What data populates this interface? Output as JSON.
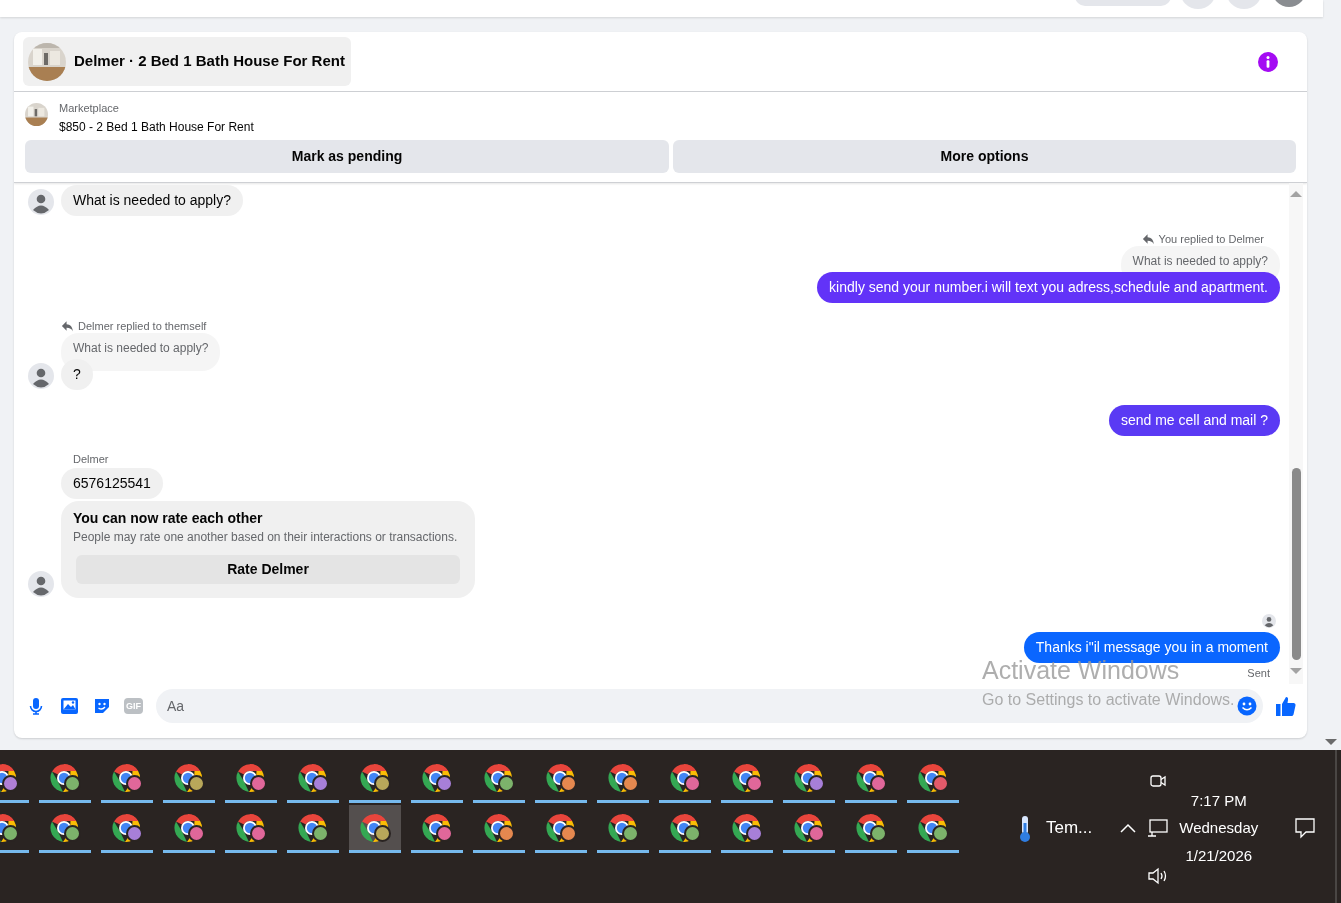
{
  "chat_header": {
    "title": "Delmer · 2 Bed 1 Bath House For Rent"
  },
  "listing": {
    "source": "Marketplace",
    "title": "$850 - 2 Bed 1 Bath House For Rent",
    "actions": [
      "Mark as pending",
      "More options"
    ]
  },
  "messages": [
    {
      "kind": "incoming",
      "avatar": true,
      "bubbles": [
        {
          "text": "What is needed to apply?"
        }
      ]
    },
    {
      "kind": "outgoing",
      "reply_note": "You replied to Delmer",
      "quoted": "What is needed to apply?",
      "bubbles": [
        {
          "text": "kindly send your number.i will text you adress,schedule and apartment.",
          "color": "#6233f8"
        }
      ]
    },
    {
      "kind": "incoming",
      "avatar": true,
      "reply_note": "Delmer replied to themself",
      "quoted": "What is needed to apply?",
      "bubbles": [
        {
          "text": "?"
        }
      ]
    },
    {
      "kind": "outgoing",
      "bubbles": [
        {
          "text": "send me cell and mail ?",
          "color": "#5a3af4"
        }
      ]
    },
    {
      "kind": "incoming",
      "avatar": true,
      "sender": "Delmer",
      "bubbles": [
        {
          "text": "6576125541"
        }
      ],
      "rating_card": {
        "title": "You can now rate each other",
        "body": "People may rate one another based on their interactions or transactions.",
        "button": "Rate Delmer"
      }
    },
    {
      "kind": "outgoing",
      "read_receipt": true,
      "bubbles": [
        {
          "text": "Thanks i\"il message you in a moment",
          "color": "#0a66ff"
        }
      ],
      "status": "Sent"
    }
  ],
  "composer": {
    "placeholder": "Aa",
    "gif_label": "GIF"
  },
  "os_notice": {
    "title": "Activate Windows",
    "subtitle": "Go to Settings to activate Windows."
  },
  "taskbar": {
    "rows": [
      [
        {
          "color": "#b07fd6",
          "selected": false
        },
        {
          "color": "#7cb36b",
          "selected": false
        },
        {
          "color": "#e0679a",
          "selected": false
        },
        {
          "color": "#b8a75a",
          "selected": false
        },
        {
          "color": "#e0679a",
          "selected": false
        },
        {
          "color": "#a77fd8",
          "selected": false
        },
        {
          "color": "#b8a75a",
          "selected": false
        },
        {
          "color": "#a77fd8",
          "selected": false
        },
        {
          "color": "#7cb36b",
          "selected": false
        },
        {
          "color": "#e5884f",
          "selected": false
        },
        {
          "color": "#e5884f",
          "selected": false
        },
        {
          "color": "#e0679a",
          "selected": false
        },
        {
          "color": "#e0679a",
          "selected": false
        },
        {
          "color": "#a77fd8",
          "selected": false
        },
        {
          "color": "#e0679a",
          "selected": false
        },
        {
          "color": "#e25a6a",
          "selected": false
        }
      ],
      [
        {
          "color": "#7cb36b",
          "selected": false
        },
        {
          "color": "#7cb36b",
          "selected": false
        },
        {
          "color": "#a77fd8",
          "selected": false
        },
        {
          "color": "#e0679a",
          "selected": false
        },
        {
          "color": "#e0679a",
          "selected": false
        },
        {
          "color": "#7cb36b",
          "selected": false
        },
        {
          "color": "#b8a75a",
          "selected": true
        },
        {
          "color": "#e0679a",
          "selected": false
        },
        {
          "color": "#e5884f",
          "selected": false
        },
        {
          "color": "#e5884f",
          "selected": false
        },
        {
          "color": "#7cb36b",
          "selected": false
        },
        {
          "color": "#7cb36b",
          "selected": false
        },
        {
          "color": "#a77fd8",
          "selected": false
        },
        {
          "color": "#e0679a",
          "selected": false
        },
        {
          "color": "#7cb36b",
          "selected": false
        },
        {
          "color": "#7cb36b",
          "selected": false
        }
      ]
    ],
    "weather": "Tem...",
    "time": "7:17 PM",
    "day": "Wednesday",
    "date": "1/21/2026"
  }
}
